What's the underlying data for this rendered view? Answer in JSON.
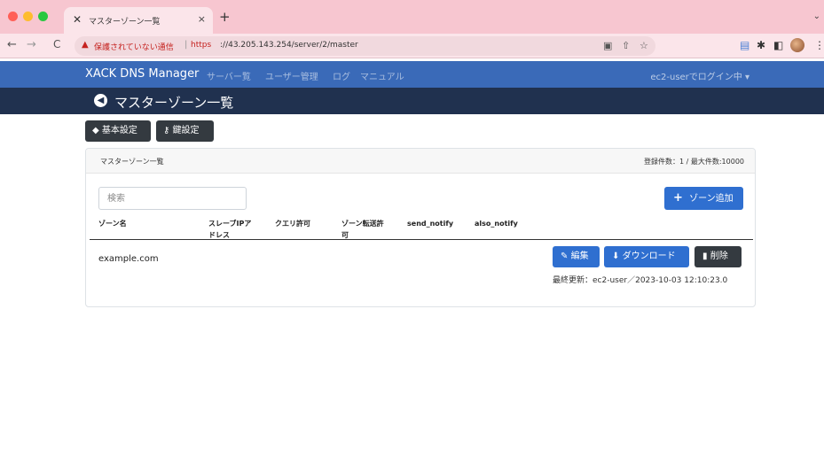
{
  "browser": {
    "tab_title": "マスターゾーン一覧",
    "tab_close": "×",
    "new_tab": "+",
    "security_label": "保護されていない通信",
    "url_scheme": "https",
    "url_rest": "://43.205.143.254/server/2/master"
  },
  "navbar": {
    "brand": "XACK DNS Manager",
    "links": [
      "サーバー覧",
      "ユーザー管理",
      "ログ",
      "マニュアル"
    ],
    "user": "ec2-userでログイン中 ▾"
  },
  "page": {
    "title": "マスターゾーン一覧",
    "buttons": {
      "basic_settings": "基本設定",
      "key_settings": "鍵設定"
    }
  },
  "card": {
    "title": "マスターゾーン一覧",
    "count": "登録件数：1 / 最大件数:10000",
    "search_placeholder": "検索",
    "add_button": "ゾーン追加",
    "columns": [
      [
        "ゾーン名"
      ],
      [
        "スレーブIPア",
        "ドレス"
      ],
      [
        "クエリ許可"
      ],
      [
        "ゾーン転送許",
        "可"
      ],
      [
        "send_notify"
      ],
      [
        "also_notify"
      ]
    ],
    "rows": [
      {
        "zone": "example.com",
        "edit": "編集",
        "download": "ダウンロード",
        "delete": "削除",
        "updated": "最終更新：ec2-user／2023-10-03 12:10:23.0"
      }
    ]
  },
  "colors": {
    "navbar": "#3a6ab8",
    "titlebar": "#20314f",
    "primary": "#2f6fd0",
    "dark": "#343a40",
    "tabbar": "#f7c6d0"
  },
  "icons": {
    "back": "arrow-left-circle-icon",
    "tag": "tag-icon",
    "key": "key-icon",
    "plus": "plus-icon",
    "edit": "pencil-icon",
    "download": "file-download-icon",
    "delete": "trash-icon"
  }
}
